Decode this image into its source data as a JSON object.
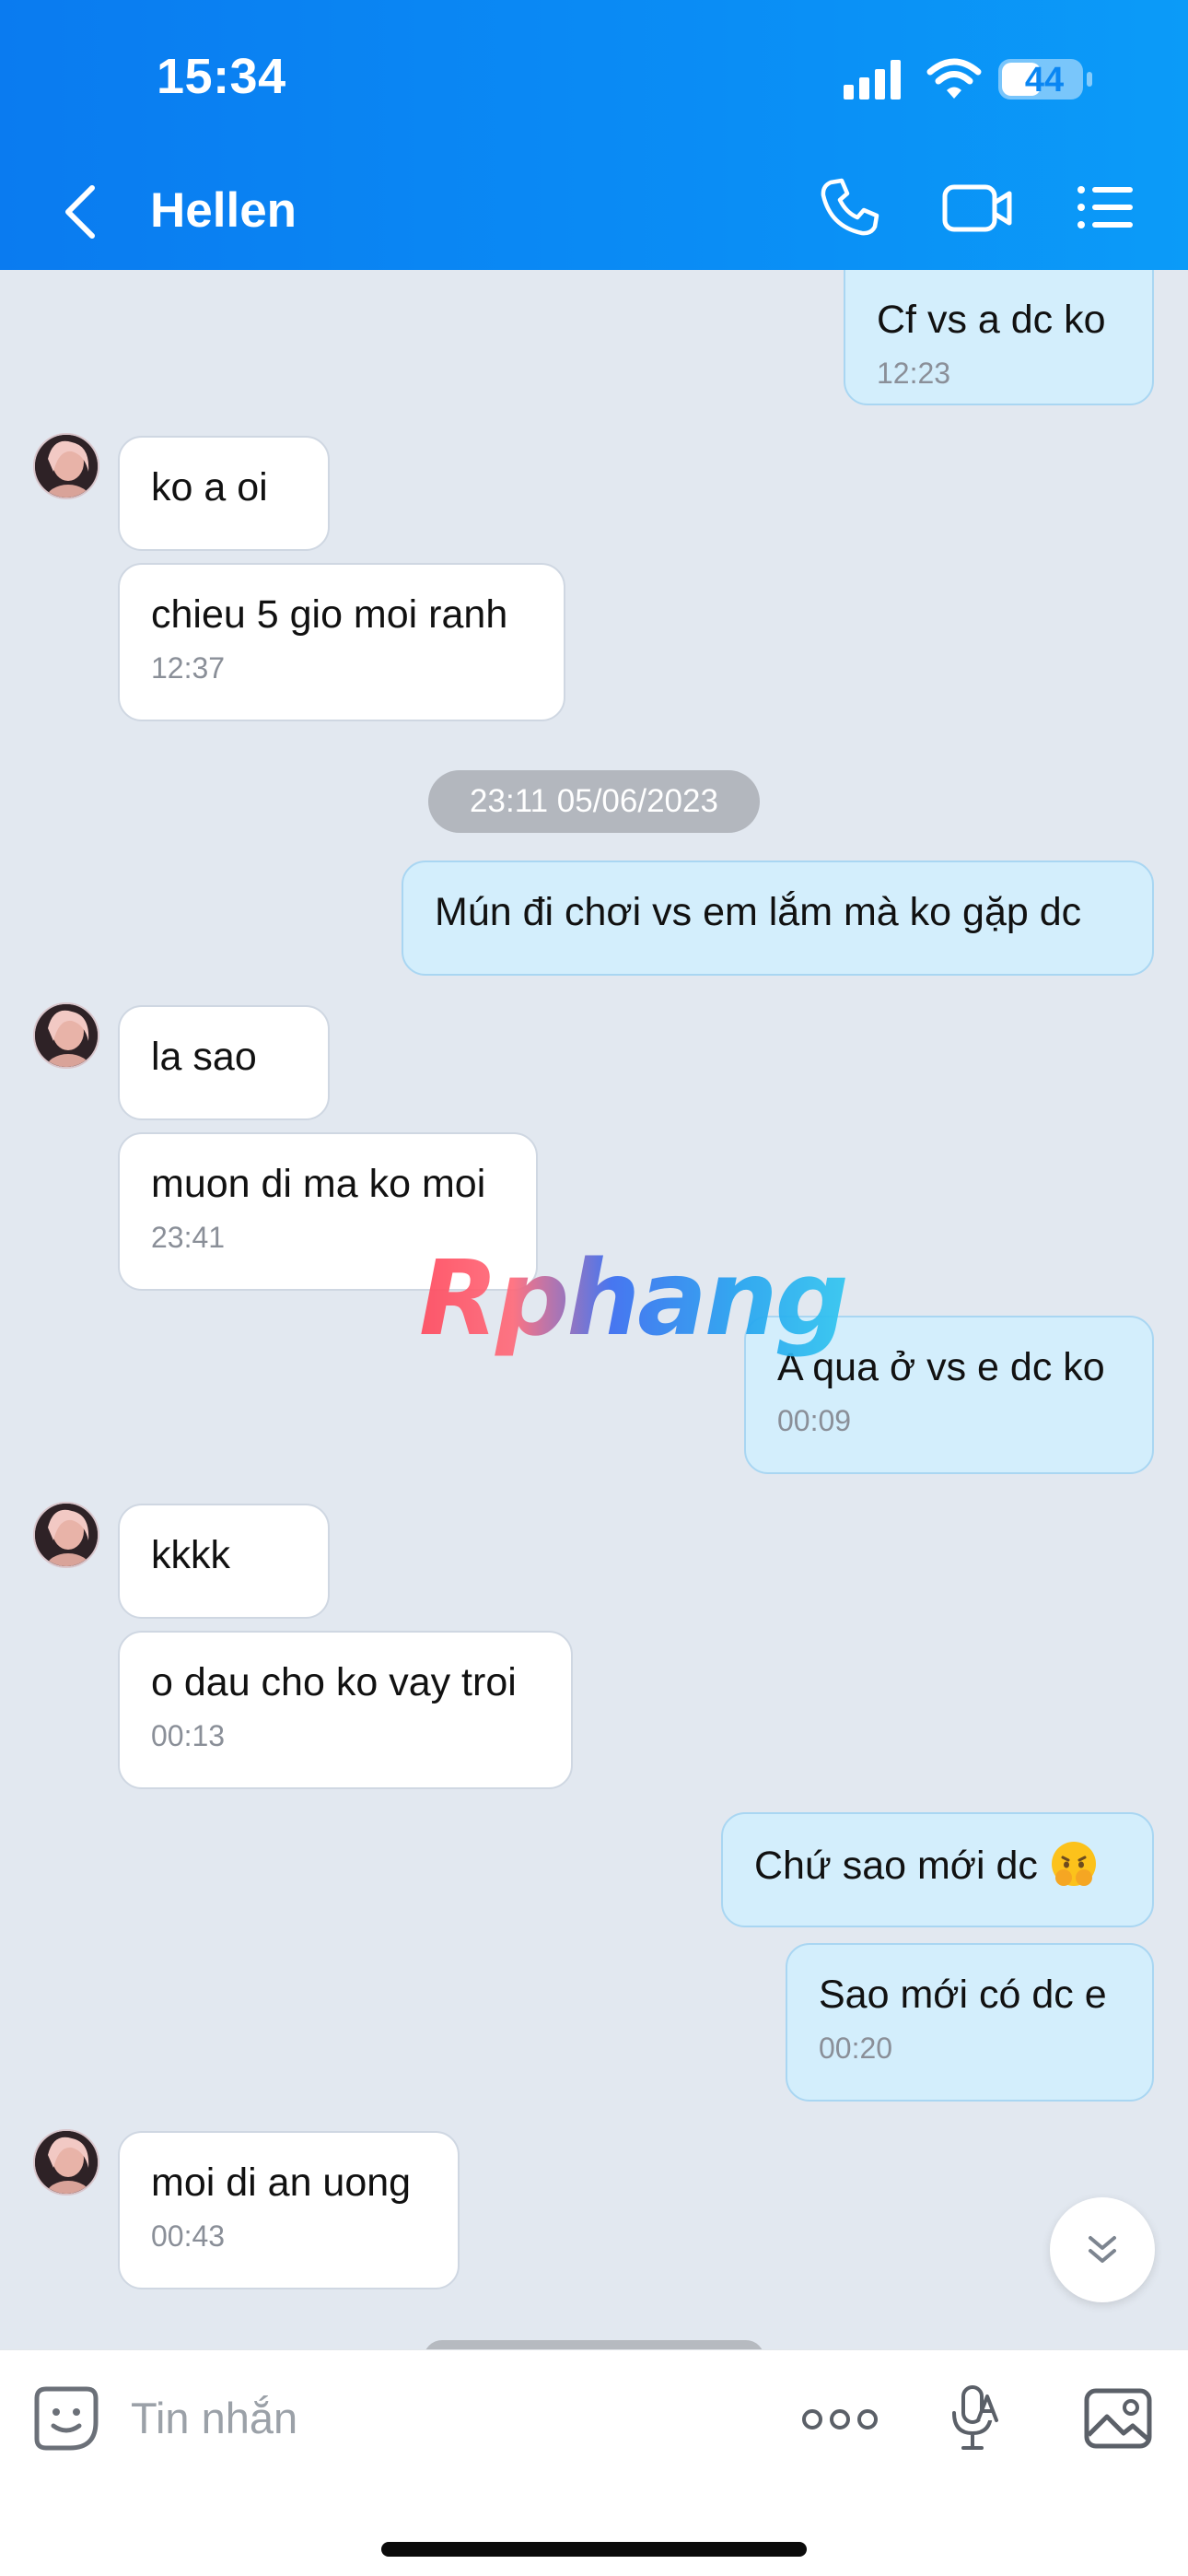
{
  "status_bar": {
    "time": "15:34",
    "battery": "44"
  },
  "header": {
    "contact_name": "Hellen",
    "icons": [
      "back-arrow-icon",
      "phone-icon",
      "video-call-icon",
      "options-list-icon"
    ]
  },
  "messages": [
    {
      "side": "me",
      "text": "Cf vs a dc ko",
      "time": "12:23"
    },
    {
      "side": "them",
      "text": "ko a oi"
    },
    {
      "side": "them",
      "text": "chieu 5 gio moi ranh",
      "time": "12:37"
    },
    {
      "type": "date",
      "text": "23:11 05/06/2023"
    },
    {
      "side": "me",
      "text": "Mún đi chơi vs em lắm mà ko gặp dc"
    },
    {
      "side": "them",
      "text": "la sao"
    },
    {
      "side": "them",
      "text": "muon di ma ko moi",
      "time": "23:41"
    },
    {
      "side": "me",
      "text": "A qua ở vs e dc ko",
      "time": "00:09"
    },
    {
      "side": "them",
      "text": "kkkk"
    },
    {
      "side": "them",
      "text": "o dau cho ko vay troi",
      "time": "00:13"
    },
    {
      "side": "me",
      "text": "Chứ sao mới dc",
      "emoji": "flushed-hands-face-emoji"
    },
    {
      "side": "me",
      "text": "Sao mới có dc e",
      "time": "00:20"
    },
    {
      "side": "them",
      "text": "moi di an uong",
      "time": "00:43"
    }
  ],
  "watermark": "Rphang",
  "composer": {
    "placeholder": "Tin nhắn",
    "icons": [
      "sticker-icon",
      "more-dots-icon",
      "voice-to-text-icon",
      "image-icon"
    ]
  },
  "colors": {
    "header": "#0a86f3",
    "chat_bg": "#e2e8f0",
    "my_bubble": "#d3eefc",
    "their_bubble": "#ffffff"
  }
}
